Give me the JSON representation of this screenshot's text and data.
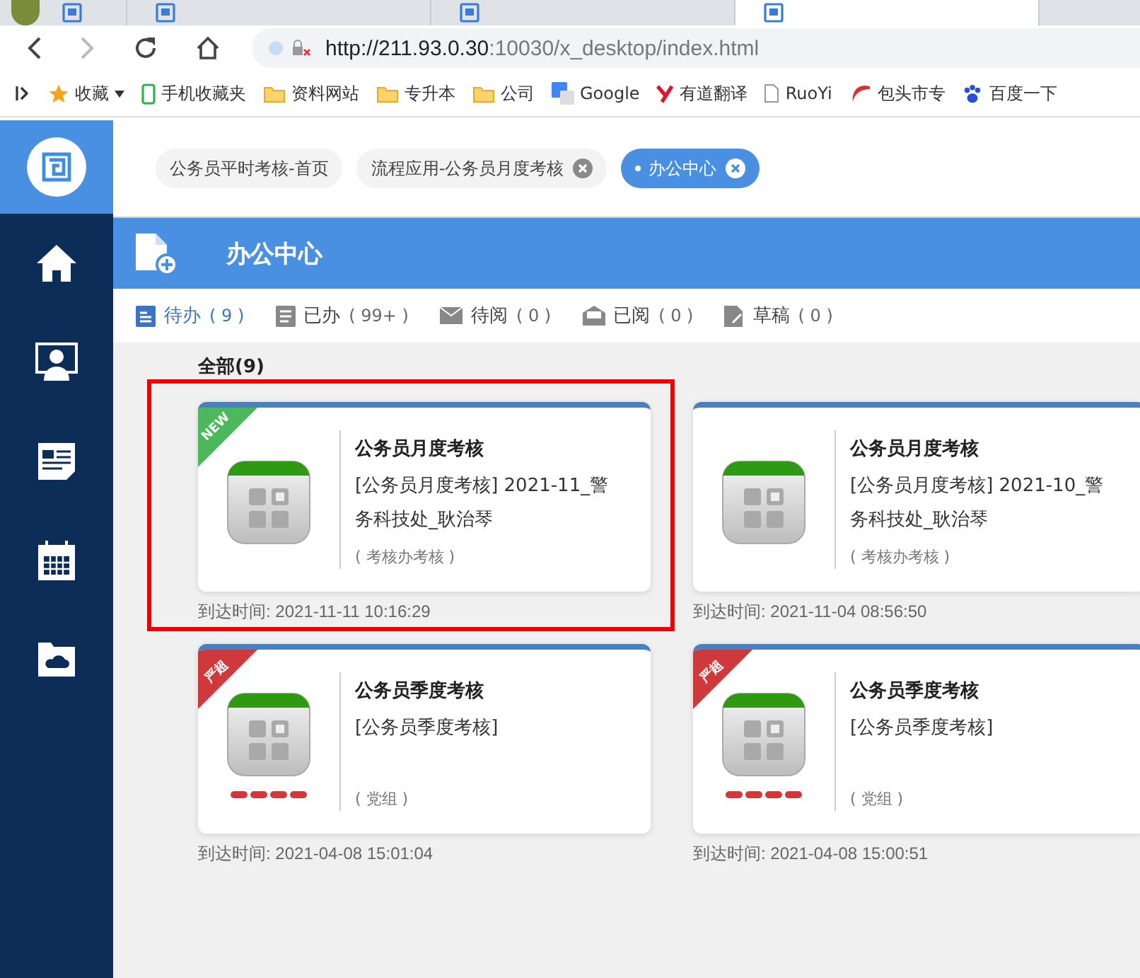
{
  "browser": {
    "tabs": [
      {
        "selected": false,
        "avatar": true
      },
      {
        "selected": false,
        "avatar": false
      },
      {
        "selected": false,
        "avatar": false
      },
      {
        "selected": true,
        "avatar": false
      }
    ],
    "url_host": "http://211.93.0.30",
    "url_rest": ":10030/x_desktop/index.html",
    "bookmarks": [
      {
        "label": "收藏",
        "kind": "star"
      },
      {
        "label": "手机收藏夹",
        "kind": "phone"
      },
      {
        "label": "资料网站",
        "kind": "folder"
      },
      {
        "label": "专升本",
        "kind": "folder"
      },
      {
        "label": "公司",
        "kind": "folder"
      },
      {
        "label": "Google",
        "kind": "translate"
      },
      {
        "label": "有道翻译",
        "kind": "youdao"
      },
      {
        "label": "RuoYi",
        "kind": "page"
      },
      {
        "label": "包头市专",
        "kind": "swoosh"
      },
      {
        "label": "百度一下",
        "kind": "paw"
      }
    ]
  },
  "sidebar": {
    "items": [
      {
        "kind": "home"
      },
      {
        "kind": "person"
      },
      {
        "kind": "news"
      },
      {
        "kind": "calendar"
      },
      {
        "kind": "cloud"
      }
    ]
  },
  "app_tabs": [
    {
      "label": "公务员平时考核-首页",
      "selected": false,
      "closable": false
    },
    {
      "label": "流程应用-公务员月度考核",
      "selected": false,
      "closable": true
    },
    {
      "label": "办公中心",
      "selected": true,
      "closable": true
    }
  ],
  "header": {
    "title": "办公中心"
  },
  "filters": [
    {
      "label": "待办",
      "count": "( 9 )",
      "kind": "todo",
      "selected": true
    },
    {
      "label": "已办",
      "count": "( 99+ )",
      "kind": "done",
      "selected": false
    },
    {
      "label": "待阅",
      "count": "( 0 )",
      "kind": "mail",
      "selected": false
    },
    {
      "label": "已阅",
      "count": "( 0 )",
      "kind": "openmail",
      "selected": false
    },
    {
      "label": "草稿",
      "count": "( 0 )",
      "kind": "draft",
      "selected": false
    }
  ],
  "section_title": "全部(9)",
  "cards": [
    {
      "title": "公务员月度考核",
      "body": "[公务员月度考核]  2021-11_警务科技处_耿治琴",
      "note": "( 考核办考核 )",
      "badge": {
        "kind": "new",
        "label": "NEW"
      },
      "alert": false,
      "highlighted": true,
      "time": "到达时间: 2021-11-11 10:16:29"
    },
    {
      "title": "公务员月度考核",
      "body": "[公务员月度考核]  2021-10_警务科技处_耿治琴",
      "note": "( 考核办考核 )",
      "alert": false,
      "highlighted": false,
      "time": "到达时间: 2021-11-04 08:56:50"
    },
    {
      "title": "公务员季度考核",
      "body": "[公务员季度考核]",
      "note": "( 党组 )",
      "badge": {
        "kind": "overdue",
        "label": "严超"
      },
      "alert": true,
      "highlighted": false,
      "time": "到达时间: 2021-04-08 15:01:04"
    },
    {
      "title": "公务员季度考核",
      "body": "[公务员季度考核]",
      "note": "( 党组 )",
      "badge": {
        "kind": "overdue",
        "label": "严超"
      },
      "alert": true,
      "highlighted": false,
      "time": "到达时间: 2021-04-08 15:00:51"
    }
  ]
}
